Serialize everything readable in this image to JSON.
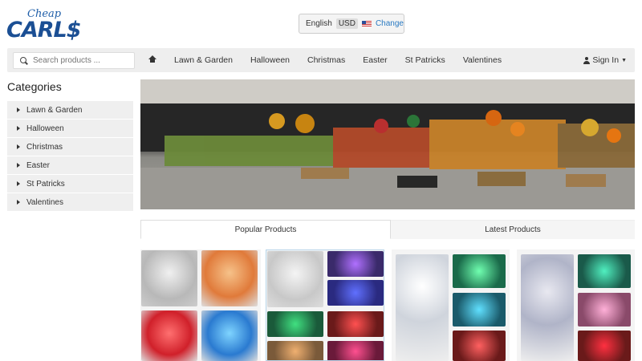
{
  "brand": {
    "top": "Cheap",
    "main": "CARL$"
  },
  "currency": {
    "language": "English",
    "code": "USD",
    "change_label": "Change"
  },
  "search": {
    "placeholder": "Search products ..."
  },
  "nav": {
    "items": [
      "Lawn & Garden",
      "Halloween",
      "Christmas",
      "Easter",
      "St Patricks",
      "Valentines"
    ],
    "signin_label": "Sign In"
  },
  "sidebar": {
    "title": "Categories",
    "items": [
      "Lawn & Garden",
      "Halloween",
      "Christmas",
      "Easter",
      "St Patricks",
      "Valentines"
    ]
  },
  "tabs": {
    "popular": "Popular Products",
    "latest": "Latest Products"
  },
  "colors": {
    "brand_blue": "#1b4f94",
    "link": "#2a7ac2",
    "nav_bg": "#eeeeee"
  }
}
